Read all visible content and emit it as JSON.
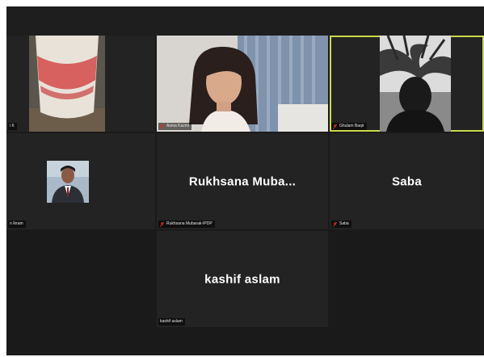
{
  "meeting": {
    "participants": [
      {
        "id": "p1",
        "name_tag": "i K",
        "has_video": true
      },
      {
        "id": "p2",
        "name_tag": "Asma Kazmi",
        "has_video": true,
        "muted": true
      },
      {
        "id": "p3",
        "name_tag": "Ghulam Baqir",
        "has_video": true,
        "muted": true,
        "active_speaker": true
      },
      {
        "id": "p4",
        "name_tag": "n Ikram",
        "has_video": true
      },
      {
        "id": "p5",
        "name_tag": "Rukhsana Mubarak-IPDP",
        "display_name": "Rukhsana  Muba...",
        "has_video": false,
        "muted": true
      },
      {
        "id": "p6",
        "name_tag": "Saba",
        "display_name": "Saba",
        "has_video": false,
        "muted": true
      },
      {
        "id": "p7",
        "name_tag": "kashif aslam",
        "display_name": "kashif aslam",
        "has_video": false
      }
    ]
  },
  "colors": {
    "background": "#1a1a1a",
    "tile": "#232323",
    "active_speaker_border": "#c9d94a",
    "muted_icon": "#e02828",
    "name_text": "#ffffff"
  },
  "icons": {
    "muted": "mic-muted-icon"
  }
}
